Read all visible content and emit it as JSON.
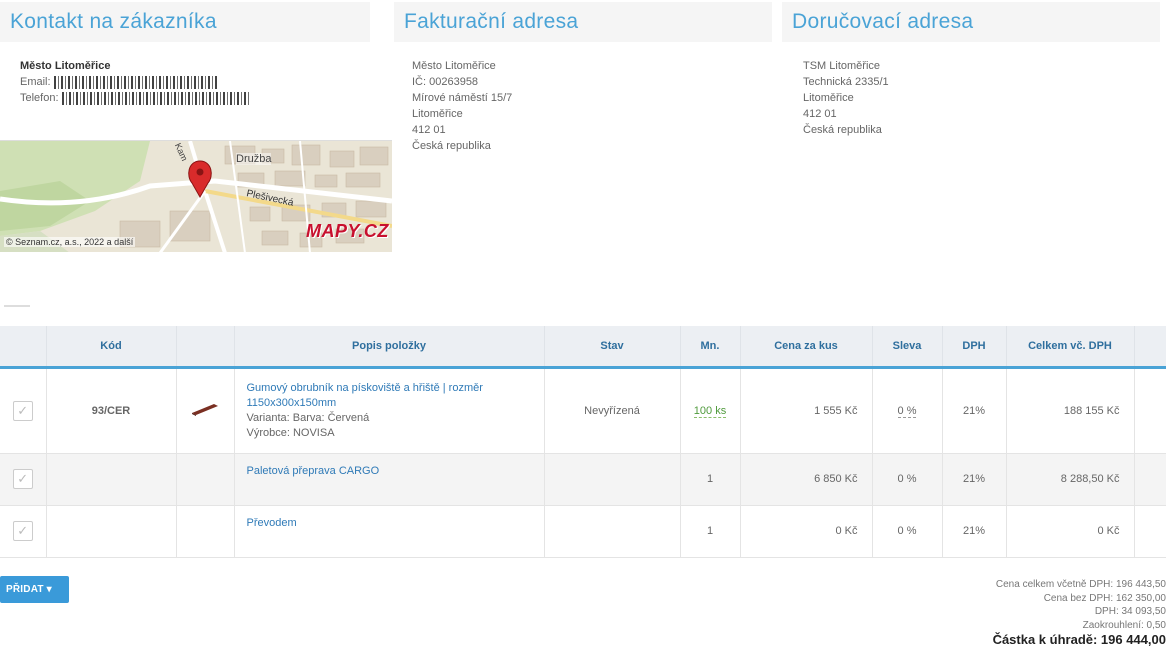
{
  "sections": {
    "contact": {
      "heading": "Kontakt na zákazníka",
      "name": "Město Litoměřice",
      "email_label": "Email:",
      "phone_label": "Telefon:"
    },
    "billing": {
      "heading": "Fakturační adresa",
      "lines": [
        "Město Litoměřice",
        "IČ: 00263958",
        "Mírové náměstí 15/7",
        "Litoměřice",
        "412 01",
        "Česká republika"
      ]
    },
    "delivery": {
      "heading": "Doručovací adresa",
      "lines": [
        "TSM Litoměřice",
        "Technická 2335/1",
        "Litoměřice",
        "412 01",
        "Česká republika"
      ]
    }
  },
  "map": {
    "labels": [
      "Družba",
      "Plešivecká",
      "Kam"
    ],
    "brand": "MAPY.CZ",
    "copyright": "© Seznam.cz, a.s., 2022 a další"
  },
  "table": {
    "headers": [
      "",
      "Kód",
      "",
      "Popis položky",
      "Stav",
      "Mn.",
      "Cena za kus",
      "Sleva",
      "DPH",
      "Celkem vč. DPH"
    ],
    "rows": [
      {
        "code": "93/CER",
        "description": "Gumový obrubník na pískoviště a hřiště | rozměr 1150x300x150mm",
        "variant": "Varianta: Barva: Červená",
        "manufacturer": "Výrobce: NOVISA",
        "status": "Nevyřízená",
        "quantity": "100 ks",
        "unit_price": "1 555 Kč",
        "discount": "0 %",
        "vat": "21%",
        "total": "188 155 Kč"
      },
      {
        "code": "",
        "description": "Paletová přeprava CARGO",
        "status": "",
        "quantity": "1",
        "unit_price": "6 850 Kč",
        "discount": "0 %",
        "vat": "21%",
        "total": "8 288,50 Kč"
      },
      {
        "code": "",
        "description": "Převodem",
        "status": "",
        "quantity": "1",
        "unit_price": "0 Kč",
        "discount": "0 %",
        "vat": "21%",
        "total": "0 Kč"
      }
    ]
  },
  "actions": {
    "add_label": "PŘIDAT ▾"
  },
  "summary": {
    "total_incl_vat": "Cena celkem včetně DPH: 196 443,50",
    "total_excl_vat": "Cena bez DPH: 162 350,00",
    "vat": "DPH: 34 093,50",
    "rounding": "Zaokrouhlení: 0,50",
    "amount_due": "Částka k úhradě: 196 444,00"
  },
  "colors": {
    "accent": "#4aa3d6",
    "link": "#2f7ab7",
    "green": "#5a9e3a",
    "button": "#3a9ad9"
  }
}
